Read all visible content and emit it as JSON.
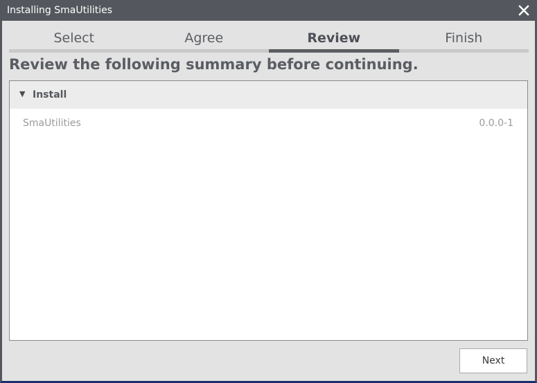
{
  "window": {
    "title": "Installing SmaUtilities",
    "close_icon": "close-icon"
  },
  "tabs": [
    {
      "label": "Select",
      "active": false
    },
    {
      "label": "Agree",
      "active": false
    },
    {
      "label": "Review",
      "active": true
    },
    {
      "label": "Finish",
      "active": false
    }
  ],
  "main": {
    "heading": "Review the following summary before continuing."
  },
  "summary": {
    "group": {
      "label": "Install",
      "expanded": true,
      "arrow_icon": "triangle-down-icon",
      "items": [
        {
          "name": "SmaUtilities",
          "version": "0.0.0-1"
        }
      ]
    }
  },
  "footer": {
    "next_label": "Next"
  },
  "colors": {
    "titlebar": "#54575d",
    "active_tab_bar": "#5b5e63",
    "inactive_tab_bar": "#c9c9c9",
    "window_background": "#e3e3e3"
  }
}
